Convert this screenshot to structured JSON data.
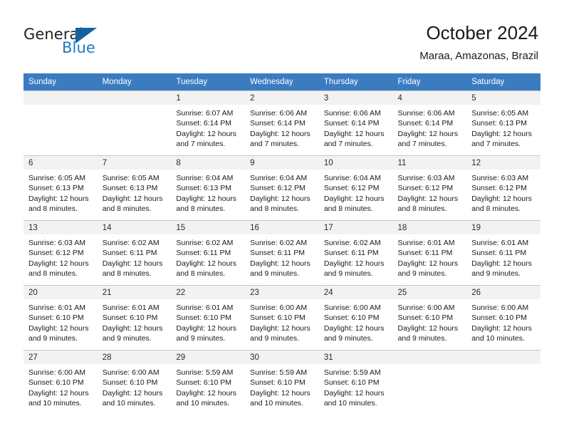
{
  "brand": {
    "name_part1": "General",
    "name_part2": "Blue",
    "sail_icon": "triangle-sail-icon",
    "color_dark": "#231f20",
    "color_blue": "#1f7ac0",
    "color_sail": "#15619e"
  },
  "header": {
    "title": "October 2024",
    "subtitle": "Maraa, Amazonas, Brazil"
  },
  "theme": {
    "header_row_bg": "#3b7cc0",
    "header_row_text": "#ffffff",
    "daynum_band_bg": "#f2f2f2",
    "cell_bg": "#ffffff",
    "grid_line": "#c8c8c8"
  },
  "calendar": {
    "weekday_headers": [
      "Sunday",
      "Monday",
      "Tuesday",
      "Wednesday",
      "Thursday",
      "Friday",
      "Saturday"
    ],
    "weeks": [
      [
        {
          "day": "",
          "empty": true
        },
        {
          "day": "",
          "empty": true
        },
        {
          "day": "1",
          "sunrise": "Sunrise: 6:07 AM",
          "sunset": "Sunset: 6:14 PM",
          "daylight1": "Daylight: 12 hours",
          "daylight2": "and 7 minutes."
        },
        {
          "day": "2",
          "sunrise": "Sunrise: 6:06 AM",
          "sunset": "Sunset: 6:14 PM",
          "daylight1": "Daylight: 12 hours",
          "daylight2": "and 7 minutes."
        },
        {
          "day": "3",
          "sunrise": "Sunrise: 6:06 AM",
          "sunset": "Sunset: 6:14 PM",
          "daylight1": "Daylight: 12 hours",
          "daylight2": "and 7 minutes."
        },
        {
          "day": "4",
          "sunrise": "Sunrise: 6:06 AM",
          "sunset": "Sunset: 6:14 PM",
          "daylight1": "Daylight: 12 hours",
          "daylight2": "and 7 minutes."
        },
        {
          "day": "5",
          "sunrise": "Sunrise: 6:05 AM",
          "sunset": "Sunset: 6:13 PM",
          "daylight1": "Daylight: 12 hours",
          "daylight2": "and 7 minutes."
        }
      ],
      [
        {
          "day": "6",
          "sunrise": "Sunrise: 6:05 AM",
          "sunset": "Sunset: 6:13 PM",
          "daylight1": "Daylight: 12 hours",
          "daylight2": "and 8 minutes."
        },
        {
          "day": "7",
          "sunrise": "Sunrise: 6:05 AM",
          "sunset": "Sunset: 6:13 PM",
          "daylight1": "Daylight: 12 hours",
          "daylight2": "and 8 minutes."
        },
        {
          "day": "8",
          "sunrise": "Sunrise: 6:04 AM",
          "sunset": "Sunset: 6:13 PM",
          "daylight1": "Daylight: 12 hours",
          "daylight2": "and 8 minutes."
        },
        {
          "day": "9",
          "sunrise": "Sunrise: 6:04 AM",
          "sunset": "Sunset: 6:12 PM",
          "daylight1": "Daylight: 12 hours",
          "daylight2": "and 8 minutes."
        },
        {
          "day": "10",
          "sunrise": "Sunrise: 6:04 AM",
          "sunset": "Sunset: 6:12 PM",
          "daylight1": "Daylight: 12 hours",
          "daylight2": "and 8 minutes."
        },
        {
          "day": "11",
          "sunrise": "Sunrise: 6:03 AM",
          "sunset": "Sunset: 6:12 PM",
          "daylight1": "Daylight: 12 hours",
          "daylight2": "and 8 minutes."
        },
        {
          "day": "12",
          "sunrise": "Sunrise: 6:03 AM",
          "sunset": "Sunset: 6:12 PM",
          "daylight1": "Daylight: 12 hours",
          "daylight2": "and 8 minutes."
        }
      ],
      [
        {
          "day": "13",
          "sunrise": "Sunrise: 6:03 AM",
          "sunset": "Sunset: 6:12 PM",
          "daylight1": "Daylight: 12 hours",
          "daylight2": "and 8 minutes."
        },
        {
          "day": "14",
          "sunrise": "Sunrise: 6:02 AM",
          "sunset": "Sunset: 6:11 PM",
          "daylight1": "Daylight: 12 hours",
          "daylight2": "and 8 minutes."
        },
        {
          "day": "15",
          "sunrise": "Sunrise: 6:02 AM",
          "sunset": "Sunset: 6:11 PM",
          "daylight1": "Daylight: 12 hours",
          "daylight2": "and 8 minutes."
        },
        {
          "day": "16",
          "sunrise": "Sunrise: 6:02 AM",
          "sunset": "Sunset: 6:11 PM",
          "daylight1": "Daylight: 12 hours",
          "daylight2": "and 9 minutes."
        },
        {
          "day": "17",
          "sunrise": "Sunrise: 6:02 AM",
          "sunset": "Sunset: 6:11 PM",
          "daylight1": "Daylight: 12 hours",
          "daylight2": "and 9 minutes."
        },
        {
          "day": "18",
          "sunrise": "Sunrise: 6:01 AM",
          "sunset": "Sunset: 6:11 PM",
          "daylight1": "Daylight: 12 hours",
          "daylight2": "and 9 minutes."
        },
        {
          "day": "19",
          "sunrise": "Sunrise: 6:01 AM",
          "sunset": "Sunset: 6:11 PM",
          "daylight1": "Daylight: 12 hours",
          "daylight2": "and 9 minutes."
        }
      ],
      [
        {
          "day": "20",
          "sunrise": "Sunrise: 6:01 AM",
          "sunset": "Sunset: 6:10 PM",
          "daylight1": "Daylight: 12 hours",
          "daylight2": "and 9 minutes."
        },
        {
          "day": "21",
          "sunrise": "Sunrise: 6:01 AM",
          "sunset": "Sunset: 6:10 PM",
          "daylight1": "Daylight: 12 hours",
          "daylight2": "and 9 minutes."
        },
        {
          "day": "22",
          "sunrise": "Sunrise: 6:01 AM",
          "sunset": "Sunset: 6:10 PM",
          "daylight1": "Daylight: 12 hours",
          "daylight2": "and 9 minutes."
        },
        {
          "day": "23",
          "sunrise": "Sunrise: 6:00 AM",
          "sunset": "Sunset: 6:10 PM",
          "daylight1": "Daylight: 12 hours",
          "daylight2": "and 9 minutes."
        },
        {
          "day": "24",
          "sunrise": "Sunrise: 6:00 AM",
          "sunset": "Sunset: 6:10 PM",
          "daylight1": "Daylight: 12 hours",
          "daylight2": "and 9 minutes."
        },
        {
          "day": "25",
          "sunrise": "Sunrise: 6:00 AM",
          "sunset": "Sunset: 6:10 PM",
          "daylight1": "Daylight: 12 hours",
          "daylight2": "and 9 minutes."
        },
        {
          "day": "26",
          "sunrise": "Sunrise: 6:00 AM",
          "sunset": "Sunset: 6:10 PM",
          "daylight1": "Daylight: 12 hours",
          "daylight2": "and 10 minutes."
        }
      ],
      [
        {
          "day": "27",
          "sunrise": "Sunrise: 6:00 AM",
          "sunset": "Sunset: 6:10 PM",
          "daylight1": "Daylight: 12 hours",
          "daylight2": "and 10 minutes."
        },
        {
          "day": "28",
          "sunrise": "Sunrise: 6:00 AM",
          "sunset": "Sunset: 6:10 PM",
          "daylight1": "Daylight: 12 hours",
          "daylight2": "and 10 minutes."
        },
        {
          "day": "29",
          "sunrise": "Sunrise: 5:59 AM",
          "sunset": "Sunset: 6:10 PM",
          "daylight1": "Daylight: 12 hours",
          "daylight2": "and 10 minutes."
        },
        {
          "day": "30",
          "sunrise": "Sunrise: 5:59 AM",
          "sunset": "Sunset: 6:10 PM",
          "daylight1": "Daylight: 12 hours",
          "daylight2": "and 10 minutes."
        },
        {
          "day": "31",
          "sunrise": "Sunrise: 5:59 AM",
          "sunset": "Sunset: 6:10 PM",
          "daylight1": "Daylight: 12 hours",
          "daylight2": "and 10 minutes."
        },
        {
          "day": "",
          "empty": true
        },
        {
          "day": "",
          "empty": true
        }
      ]
    ]
  }
}
